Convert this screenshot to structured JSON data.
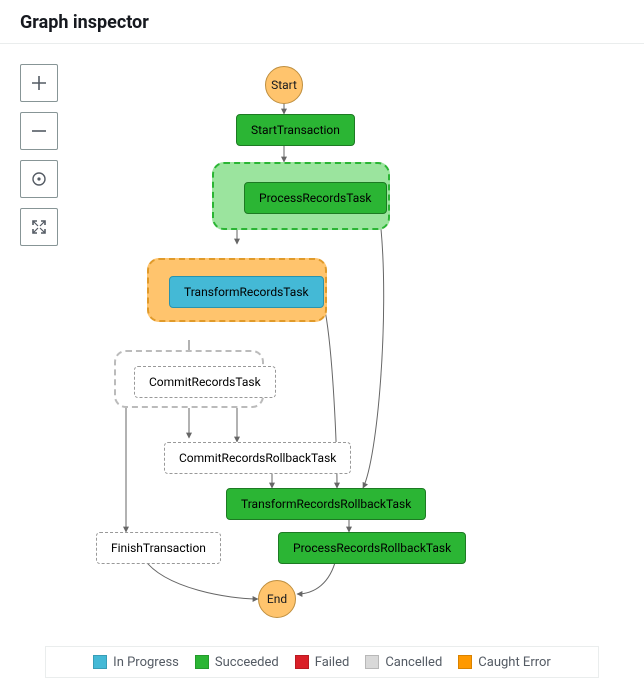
{
  "header": {
    "title": "Graph inspector"
  },
  "toolbar": {
    "zoom_in": "zoom-in",
    "zoom_out": "zoom-out",
    "center": "center",
    "fit": "fit-screen"
  },
  "graph": {
    "start": "Start",
    "end": "End",
    "nodes": {
      "start_transaction": "StartTransaction",
      "process_records_task": "ProcessRecordsTask",
      "transform_records_task": "TransformRecordsTask",
      "commit_records_task": "CommitRecordsTask",
      "commit_records_rollback_task": "CommitRecordsRollbackTask",
      "transform_records_rollback_task": "TransformRecordsRollbackTask",
      "process_records_rollback_task": "ProcessRecordsRollbackTask",
      "finish_transaction": "FinishTransaction"
    }
  },
  "legend": {
    "in_progress": "In Progress",
    "succeeded": "Succeeded",
    "failed": "Failed",
    "cancelled": "Cancelled",
    "caught_error": "Caught Error"
  },
  "chart_data": {
    "type": "flowchart",
    "title": "Graph inspector",
    "nodes": [
      {
        "id": "start",
        "label": "Start",
        "shape": "circle",
        "status": "start"
      },
      {
        "id": "n1",
        "label": "StartTransaction",
        "status": "Succeeded"
      },
      {
        "id": "n2",
        "label": "ProcessRecordsTask",
        "status": "Succeeded",
        "group": "succeeded"
      },
      {
        "id": "n3",
        "label": "TransformRecordsTask",
        "status": "In Progress",
        "group": "caught_error"
      },
      {
        "id": "n4",
        "label": "CommitRecordsTask",
        "status": "Pending",
        "group": "pending"
      },
      {
        "id": "n5",
        "label": "CommitRecordsRollbackTask",
        "status": "Pending"
      },
      {
        "id": "n6",
        "label": "TransformRecordsRollbackTask",
        "status": "Succeeded"
      },
      {
        "id": "n7",
        "label": "ProcessRecordsRollbackTask",
        "status": "Succeeded"
      },
      {
        "id": "n8",
        "label": "FinishTransaction",
        "status": "Pending"
      },
      {
        "id": "end",
        "label": "End",
        "shape": "circle",
        "status": "end"
      }
    ],
    "edges": [
      [
        "start",
        "n1"
      ],
      [
        "n1",
        "n2"
      ],
      [
        "n2",
        "n3"
      ],
      [
        "n2",
        "n6"
      ],
      [
        "n3",
        "n4"
      ],
      [
        "n3",
        "n6"
      ],
      [
        "n4",
        "n5"
      ],
      [
        "n4",
        "n8"
      ],
      [
        "n5",
        "n6"
      ],
      [
        "n6",
        "n7"
      ],
      [
        "n7",
        "end"
      ],
      [
        "n8",
        "end"
      ]
    ],
    "legend": [
      "In Progress",
      "Succeeded",
      "Failed",
      "Cancelled",
      "Caught Error"
    ]
  }
}
